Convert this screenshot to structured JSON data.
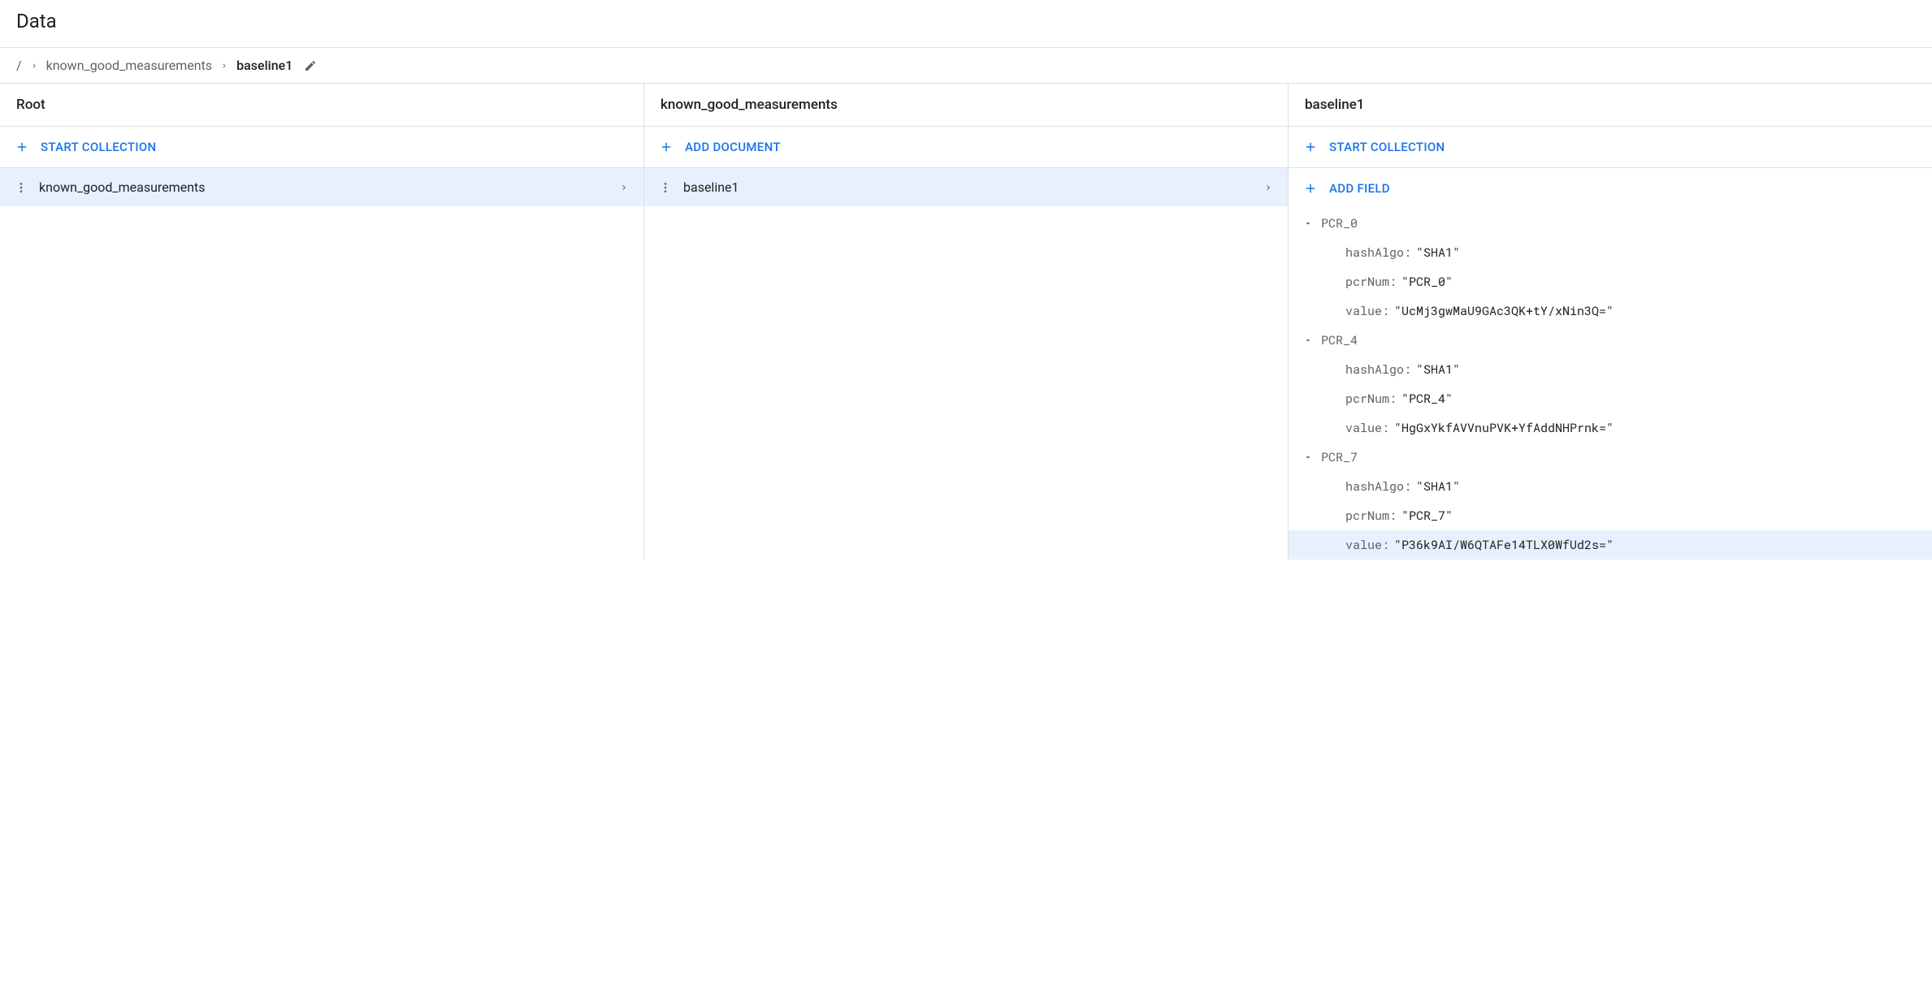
{
  "pageTitle": "Data",
  "breadcrumb": {
    "root": "/",
    "collection": "known_good_measurements",
    "document": "baseline1"
  },
  "panels": {
    "root": {
      "header": "Root",
      "action": "START COLLECTION",
      "items": [
        {
          "label": "known_good_measurements"
        }
      ]
    },
    "collection": {
      "header": "known_good_measurements",
      "action": "ADD DOCUMENT",
      "items": [
        {
          "label": "baseline1"
        }
      ]
    },
    "document": {
      "header": "baseline1",
      "actionStart": "START COLLECTION",
      "actionAddField": "ADD FIELD",
      "fields": [
        {
          "name": "PCR_0",
          "props": [
            {
              "key": "hashAlgo",
              "value": "\"SHA1\""
            },
            {
              "key": "pcrNum",
              "value": "\"PCR_0\""
            },
            {
              "key": "value",
              "value": "\"UcMj3gwMaU9GAc3QK+tY/xNin3Q=\""
            }
          ]
        },
        {
          "name": "PCR_4",
          "props": [
            {
              "key": "hashAlgo",
              "value": "\"SHA1\""
            },
            {
              "key": "pcrNum",
              "value": "\"PCR_4\""
            },
            {
              "key": "value",
              "value": "\"HgGxYkfAVVnuPVK+YfAddNHPrnk=\""
            }
          ]
        },
        {
          "name": "PCR_7",
          "props": [
            {
              "key": "hashAlgo",
              "value": "\"SHA1\""
            },
            {
              "key": "pcrNum",
              "value": "\"PCR_7\""
            },
            {
              "key": "value",
              "value": "\"P36k9AI/W6QTAFe14TLX0WfUd2s=\"",
              "highlighted": true
            }
          ]
        }
      ]
    }
  }
}
